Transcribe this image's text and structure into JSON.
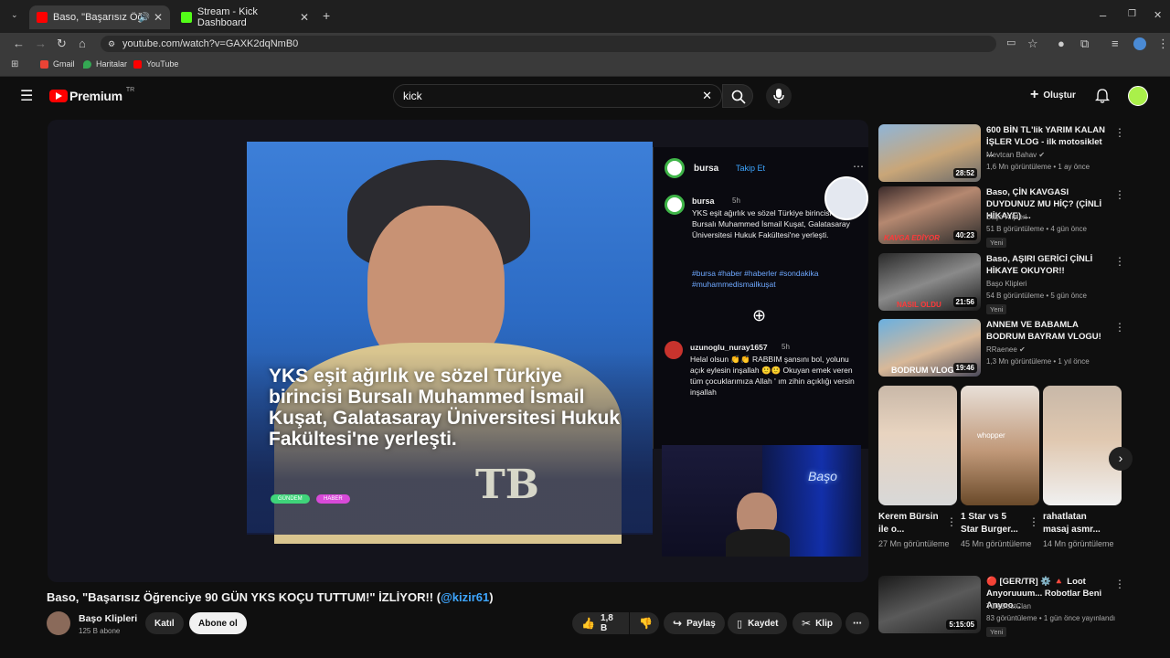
{
  "browser": {
    "tabs": [
      {
        "title": "Baso, \"Başarısız Öğrenciye 9",
        "active": true
      },
      {
        "title": "Stream - Kick Dashboard",
        "active": false
      }
    ],
    "url": "youtube.com/watch?v=GAXK2dqNmB0",
    "bookmarks": [
      "Gmail",
      "Haritalar",
      "YouTube"
    ]
  },
  "youtube": {
    "logo": "Premium",
    "region": "TR",
    "search_value": "kick",
    "create_label": "Oluştur"
  },
  "video": {
    "overlay": {
      "account": "bursa",
      "follow": "Takip Et",
      "post_time": "5h",
      "post_text": "YKS eşit ağırlık ve sözel Türkiye birincisi Bursalı Muhammed İsmail Kuşat, Galatasaray Üniversitesi Hukuk Fakültesi'ne yerleşti.",
      "hashtags": "#bursa #haber #haberler #sondakika #muhammedismailkuşat",
      "comment_user": "uzunoglu_nuray1657",
      "comment_time": "5h",
      "comment_text": "Helal olsun 👏👏 RABBIM şansını bol, yolunu açık eylesin inşallah 🙂🙂 Okuyan emek veren tüm çocuklarımıza Allah ' ım zihin açıklığı versin inşallah",
      "headline": "YKS eşit ağırlık ve sözel Türkiye birincisi Bursalı Muhammed İsmail Kuşat, Galatasaray Üniversitesi Hukuk Fakültesi'ne yerleşti.",
      "badge1": "GÜNDEM",
      "badge2": "HABER",
      "neon": "Başo"
    },
    "title_main": "Baso, \"Başarısız Öğrenciye 90 GÜN YKS KOÇU TUTTUM!\" İZLİYOR!! (",
    "title_tag": "@kizir61",
    "title_end": ")",
    "channel": "Başo Klipleri",
    "subs": "125 B abone",
    "join": "Katıl",
    "subscribe": "Abone ol",
    "likes": "1,8 B",
    "share": "Paylaş",
    "save": "Kaydet",
    "clip": "Klip"
  },
  "recommendations": [
    {
      "title": "600 BİN TL'lik YARIM KALAN İŞLER VLOG - ilk motosiklet ...",
      "channel": "Mevtcan Bahav",
      "verified": true,
      "meta": "1,6 Mn görüntüleme • 1 ay önce",
      "duration": "28:52",
      "badge": ""
    },
    {
      "title": "Baso, ÇİN KAVGASI DUYDUNUZ MU HİÇ? (ÇİNLİ HİKAYE) ...",
      "channel": "Başo Klipleri",
      "verified": false,
      "meta": "51 B görüntüleme • 4 gün önce",
      "duration": "40:23",
      "badge": "Yeni"
    },
    {
      "title": "Baso, AŞIRI GERİCİ ÇİNLİ HİKAYE OKUYOR!!",
      "channel": "Başo Klipleri",
      "verified": false,
      "meta": "54 B görüntüleme • 5 gün önce",
      "duration": "21:56",
      "badge": "Yeni"
    },
    {
      "title": "ANNEM VE BABAMLA BODRUM BAYRAM VLOGU!",
      "channel": "RRaenee",
      "verified": true,
      "meta": "1,3 Mn görüntüleme • 1 yıl önce",
      "duration": "19:46",
      "badge": ""
    }
  ],
  "shorts": [
    {
      "title": "Kerem Bürsin ile o...",
      "views": "27 Mn görüntüleme"
    },
    {
      "title": "1 Star vs 5 Star Burger...",
      "views": "45 Mn görüntüleme"
    },
    {
      "title": "rahatlatan masaj asmr...",
      "views": "14 Mn görüntüleme"
    }
  ],
  "live": {
    "title": "🔴 [GER/TR] ⚙️ 🔺 Loot Anyoruuum... Robotlar Beni Anyoo...",
    "channel": "TürkDostClan",
    "meta": "83 görüntüleme • 1 gün önce yayınlandı",
    "duration": "5:15:05",
    "badge": "Yeni"
  },
  "colors": {
    "accent_red": "#ff0000",
    "link_blue": "#3ea6ff",
    "kick_green": "#53fc18"
  }
}
